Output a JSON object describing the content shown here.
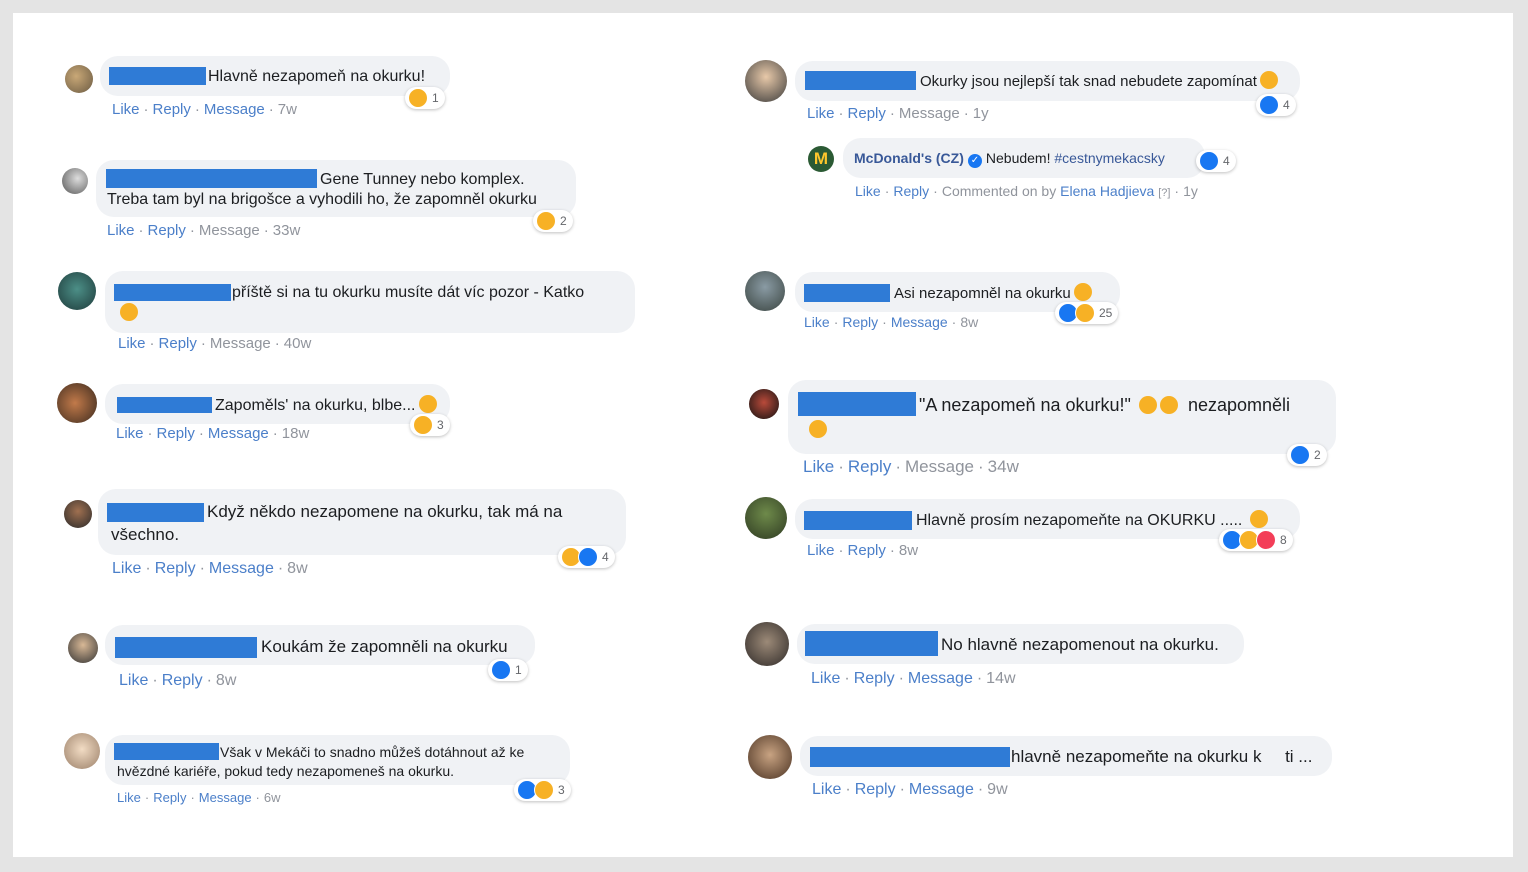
{
  "actions": {
    "like": "Like",
    "reply": "Reply",
    "message": "Message",
    "sep": "·"
  },
  "comments": [
    {
      "text": "Hlavně nezapomeň na okurku!",
      "time": "7w",
      "reactions": "1"
    },
    {
      "line1": "Gene Tunney nebo komplex.",
      "line2": "Treba tam byl na brigošce a vyhodili ho, že zapomněl okurku",
      "time": "33w",
      "reactions": "2"
    },
    {
      "text": "příště si na tu okurku musíte dát víc pozor - Katko",
      "time": "40w"
    },
    {
      "text": "Zapoměls' na okurku, blbe...",
      "time": "18w",
      "reactions": "3"
    },
    {
      "line1": "Když někdo nezapomene na okurku, tak má na",
      "line2": "všechno.",
      "time": "8w",
      "reactions": "4"
    },
    {
      "text": "Koukám že zapomněli na okurku",
      "time": "8w",
      "reactions": "1"
    },
    {
      "line1": "Však v Mekáči to snadno můžeš dotáhnout až ke",
      "line2": "hvězdné kariéře, pokud tedy nezapomeneš na okurku.",
      "time": "6w",
      "reactions": "3"
    },
    {
      "text": "Okurky jsou nejlepší tak snad nebudete zapomínat",
      "time": "1y",
      "reactions": "4"
    },
    {
      "page": "McDonald's (CZ)",
      "text": "Nebudem!",
      "hashtag": "#cestnymekacsky",
      "commented_on": "Commented on by",
      "author": "Elena Hadjieva",
      "q": "[?]",
      "time": "1y",
      "reactions": "4"
    },
    {
      "text": "Asi nezapomněl na okurku",
      "time": "8w",
      "reactions": "25"
    },
    {
      "text": "\"A nezapomeň na okurku!\"",
      "text2": "nezapomněli",
      "time": "34w",
      "reactions": "2"
    },
    {
      "text": "Hlavně prosím nezapomeňte na OKURKU .....",
      "time": "8w",
      "reactions": "8"
    },
    {
      "text": "No hlavně nezapomenout na okurku.",
      "time": "14w"
    },
    {
      "text": "hlavně nezapomeňte na okurku k",
      "text2": "ti ...",
      "time": "9w"
    }
  ],
  "colors": {
    "redaction": "#2f7bd6",
    "bubble": "#f0f2f5",
    "link": "#4b7fc9",
    "like": "#1877f2",
    "haha": "#f7b125",
    "love": "#f33e58"
  }
}
